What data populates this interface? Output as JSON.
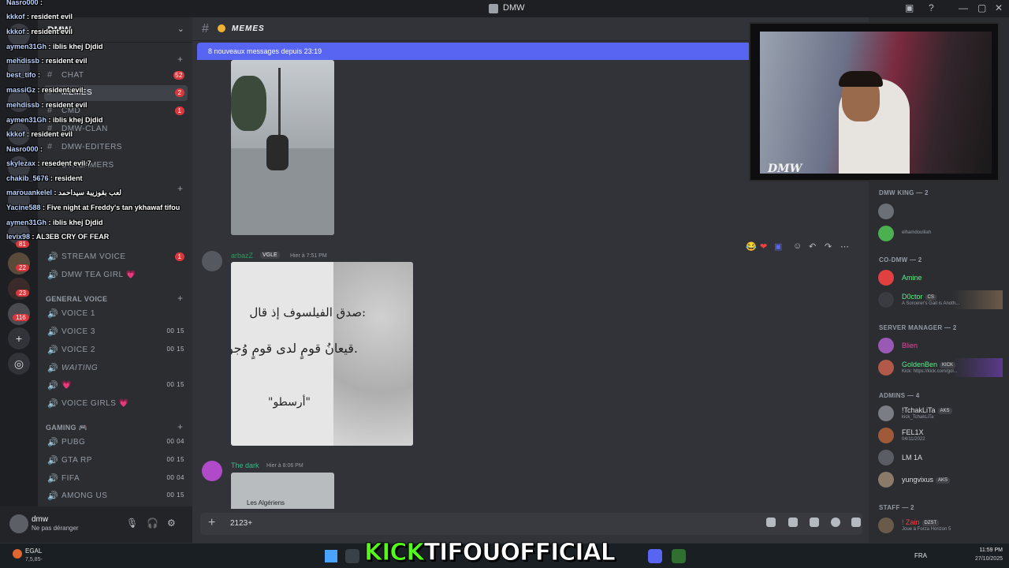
{
  "window": {
    "title": "DMW",
    "controls": [
      "—",
      "▢",
      "✕"
    ]
  },
  "server": {
    "name": "DMW"
  },
  "sidebar": {
    "channels": [
      {
        "label": "CHAT",
        "badge": "52"
      },
      {
        "label": "MEMES",
        "badge": "2"
      },
      {
        "label": "CMD",
        "badge": "1"
      },
      {
        "label": "DMW-CLAN",
        "badge": ""
      },
      {
        "label": "DMW-EDITERS",
        "badge": ""
      },
      {
        "label": "STREAMERS",
        "badge": ""
      }
    ],
    "stream_channels": [
      {
        "label": "STREAM VOICE",
        "badge": "1"
      },
      {
        "label": "DMW TEA GIRL 💗",
        "badge": ""
      }
    ],
    "general_voice_category": "GENERAL VOICE",
    "general_voice": [
      {
        "label": "VOICE 1",
        "count": ""
      },
      {
        "label": "VOICE 3",
        "count": "00 15"
      },
      {
        "label": "VOICE 2",
        "count": "00 15"
      },
      {
        "label": "WAITING",
        "count": ""
      },
      {
        "label": "💗",
        "count": "00 15"
      },
      {
        "label": "VOICE GIRLS 💗",
        "count": ""
      }
    ],
    "gaming_category": "GAMING 🎮",
    "gaming": [
      {
        "label": "PUBG",
        "count": "00 04"
      },
      {
        "label": "GTA RP",
        "count": "00 15"
      },
      {
        "label": "FIFA",
        "count": "00 04"
      },
      {
        "label": "AMONG US",
        "count": "00 15"
      }
    ]
  },
  "rail": {
    "badges": [
      "81",
      "22",
      "23",
      "116"
    ]
  },
  "user_panel": {
    "name": "dmw",
    "status": "Ne pas déranger"
  },
  "stream_chat": [
    {
      "user": "Nasro000",
      "text": ""
    },
    {
      "user": "kkkof",
      "text": "resident evil"
    },
    {
      "user": "kkkof",
      "text": "resident evil"
    },
    {
      "user": "aymen31Gh",
      "text": "iblis khej Djdid"
    },
    {
      "user": "mehdissb",
      "text": "resident evil"
    },
    {
      "user": "best_tifo",
      "text": ""
    },
    {
      "user": "massiGz",
      "text": "resident evil"
    },
    {
      "user": "mehdissb",
      "text": "resident evil"
    },
    {
      "user": "aymen31Gh",
      "text": "iblis khej Djdid"
    },
    {
      "user": "kkkof",
      "text": "resident evil"
    },
    {
      "user": "Nasro000",
      "text": ""
    },
    {
      "user": "skylezax",
      "text": "resedent evil 7"
    },
    {
      "user": "chakib_5676",
      "text": "resident"
    },
    {
      "user": "marouankelel",
      "text": "لعب بقوزيبة سيداحمد"
    },
    {
      "user": "Yacine588",
      "text": "Five night at Freddy's tan ykhawaf tifou"
    },
    {
      "user": "aymen31Gh",
      "text": "iblis khej Djdid"
    },
    {
      "user": "levix98",
      "text": "AL3EB CRY OF FEAR"
    }
  ],
  "main": {
    "channel_name": "MEMES",
    "new_messages_banner": "8 nouveaux messages depuis 23:19",
    "messages": [
      {
        "author": "arbazZ",
        "tag": "VGLE",
        "time": "Hier à 7:51 PM",
        "image_text": [
          "صدق الفيلسوف إذ قال:",
          "قيعانُ قومٍ لدى قومٍ وُجوهُ.",
          "\"أرسطو\""
        ]
      },
      {
        "author": "The dark",
        "tag": "",
        "time": "Hier à 8:06 PM",
        "image_text": [
          "Les Algériens"
        ]
      }
    ],
    "composer_text": "2123+"
  },
  "members": {
    "groups": [
      {
        "title": "DMW KING — 2",
        "members": [
          {
            "name": "",
            "sub": "",
            "color": "#dbdee1"
          },
          {
            "name": "",
            "sub": "elhamdoulilah",
            "color": "#dbdee1"
          }
        ]
      },
      {
        "title": "CO-DMW — 2",
        "members": [
          {
            "name": "Amine",
            "sub": "",
            "color": "#57f287"
          },
          {
            "name": "D0ctor",
            "chip": "CS",
            "sub": "A Sorcerer's Gait is Anoth...",
            "color": "#57f287"
          }
        ]
      },
      {
        "title": "SERVER MANAGER — 2",
        "members": [
          {
            "name": "Blien",
            "sub": "",
            "color": "#eb459e"
          },
          {
            "name": "GoldenBen",
            "chip": "KICK",
            "sub": "Kick: https://kick.com/gol...",
            "color": "#57f287"
          }
        ]
      },
      {
        "title": "ADMINS — 4",
        "members": [
          {
            "name": "!TchakLiTa",
            "chip": "AKS",
            "sub": "kick_TchakLiTa",
            "color": "#dbdee1"
          },
          {
            "name": "FEL1X",
            "chip": "",
            "sub": "04/11/2022",
            "color": "#dbdee1"
          },
          {
            "name": "LM 1A",
            "chip": "",
            "sub": "",
            "color": "#dbdee1"
          },
          {
            "name": "yungvixus",
            "chip": "AKS",
            "sub": "",
            "color": "#dbdee1"
          }
        ]
      },
      {
        "title": "STAFF — 2",
        "members": [
          {
            "name": "! Zain",
            "chip": "DZST",
            "sub": "Joue à Forza Horizon 5",
            "color": "#f23f42"
          }
        ]
      }
    ]
  },
  "webcam": {
    "overlay_logo": "DMW"
  },
  "taskbar": {
    "weather": "EGAL",
    "weather_sub": "7,5,85-",
    "language": "FRA",
    "time": "11:59 PM",
    "date": "27/10/2025"
  },
  "stream_overlay": {
    "kick": "KICK",
    "channel": "TIFOUOFFICIAL"
  },
  "colors": {
    "accent": "#5865f2",
    "badge": "#da373c",
    "kick_green": "#53fc18"
  }
}
